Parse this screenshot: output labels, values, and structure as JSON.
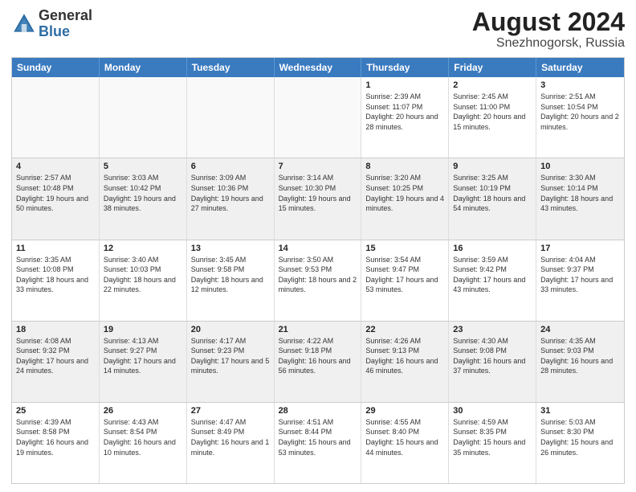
{
  "header": {
    "logo_general": "General",
    "logo_blue": "Blue",
    "title": "August 2024",
    "location": "Snezhnogorsk, Russia"
  },
  "days_of_week": [
    "Sunday",
    "Monday",
    "Tuesday",
    "Wednesday",
    "Thursday",
    "Friday",
    "Saturday"
  ],
  "rows": [
    [
      {
        "day": "",
        "info": "",
        "empty": true
      },
      {
        "day": "",
        "info": "",
        "empty": true
      },
      {
        "day": "",
        "info": "",
        "empty": true
      },
      {
        "day": "",
        "info": "",
        "empty": true
      },
      {
        "day": "1",
        "info": "Sunrise: 2:39 AM\nSunset: 11:07 PM\nDaylight: 20 hours\nand 28 minutes.",
        "empty": false
      },
      {
        "day": "2",
        "info": "Sunrise: 2:45 AM\nSunset: 11:00 PM\nDaylight: 20 hours\nand 15 minutes.",
        "empty": false
      },
      {
        "day": "3",
        "info": "Sunrise: 2:51 AM\nSunset: 10:54 PM\nDaylight: 20 hours\nand 2 minutes.",
        "empty": false
      }
    ],
    [
      {
        "day": "4",
        "info": "Sunrise: 2:57 AM\nSunset: 10:48 PM\nDaylight: 19 hours\nand 50 minutes.",
        "empty": false
      },
      {
        "day": "5",
        "info": "Sunrise: 3:03 AM\nSunset: 10:42 PM\nDaylight: 19 hours\nand 38 minutes.",
        "empty": false
      },
      {
        "day": "6",
        "info": "Sunrise: 3:09 AM\nSunset: 10:36 PM\nDaylight: 19 hours\nand 27 minutes.",
        "empty": false
      },
      {
        "day": "7",
        "info": "Sunrise: 3:14 AM\nSunset: 10:30 PM\nDaylight: 19 hours\nand 15 minutes.",
        "empty": false
      },
      {
        "day": "8",
        "info": "Sunrise: 3:20 AM\nSunset: 10:25 PM\nDaylight: 19 hours\nand 4 minutes.",
        "empty": false
      },
      {
        "day": "9",
        "info": "Sunrise: 3:25 AM\nSunset: 10:19 PM\nDaylight: 18 hours\nand 54 minutes.",
        "empty": false
      },
      {
        "day": "10",
        "info": "Sunrise: 3:30 AM\nSunset: 10:14 PM\nDaylight: 18 hours\nand 43 minutes.",
        "empty": false
      }
    ],
    [
      {
        "day": "11",
        "info": "Sunrise: 3:35 AM\nSunset: 10:08 PM\nDaylight: 18 hours\nand 33 minutes.",
        "empty": false
      },
      {
        "day": "12",
        "info": "Sunrise: 3:40 AM\nSunset: 10:03 PM\nDaylight: 18 hours\nand 22 minutes.",
        "empty": false
      },
      {
        "day": "13",
        "info": "Sunrise: 3:45 AM\nSunset: 9:58 PM\nDaylight: 18 hours\nand 12 minutes.",
        "empty": false
      },
      {
        "day": "14",
        "info": "Sunrise: 3:50 AM\nSunset: 9:53 PM\nDaylight: 18 hours\nand 2 minutes.",
        "empty": false
      },
      {
        "day": "15",
        "info": "Sunrise: 3:54 AM\nSunset: 9:47 PM\nDaylight: 17 hours\nand 53 minutes.",
        "empty": false
      },
      {
        "day": "16",
        "info": "Sunrise: 3:59 AM\nSunset: 9:42 PM\nDaylight: 17 hours\nand 43 minutes.",
        "empty": false
      },
      {
        "day": "17",
        "info": "Sunrise: 4:04 AM\nSunset: 9:37 PM\nDaylight: 17 hours\nand 33 minutes.",
        "empty": false
      }
    ],
    [
      {
        "day": "18",
        "info": "Sunrise: 4:08 AM\nSunset: 9:32 PM\nDaylight: 17 hours\nand 24 minutes.",
        "empty": false
      },
      {
        "day": "19",
        "info": "Sunrise: 4:13 AM\nSunset: 9:27 PM\nDaylight: 17 hours\nand 14 minutes.",
        "empty": false
      },
      {
        "day": "20",
        "info": "Sunrise: 4:17 AM\nSunset: 9:23 PM\nDaylight: 17 hours\nand 5 minutes.",
        "empty": false
      },
      {
        "day": "21",
        "info": "Sunrise: 4:22 AM\nSunset: 9:18 PM\nDaylight: 16 hours\nand 56 minutes.",
        "empty": false
      },
      {
        "day": "22",
        "info": "Sunrise: 4:26 AM\nSunset: 9:13 PM\nDaylight: 16 hours\nand 46 minutes.",
        "empty": false
      },
      {
        "day": "23",
        "info": "Sunrise: 4:30 AM\nSunset: 9:08 PM\nDaylight: 16 hours\nand 37 minutes.",
        "empty": false
      },
      {
        "day": "24",
        "info": "Sunrise: 4:35 AM\nSunset: 9:03 PM\nDaylight: 16 hours\nand 28 minutes.",
        "empty": false
      }
    ],
    [
      {
        "day": "25",
        "info": "Sunrise: 4:39 AM\nSunset: 8:58 PM\nDaylight: 16 hours\nand 19 minutes.",
        "empty": false
      },
      {
        "day": "26",
        "info": "Sunrise: 4:43 AM\nSunset: 8:54 PM\nDaylight: 16 hours\nand 10 minutes.",
        "empty": false
      },
      {
        "day": "27",
        "info": "Sunrise: 4:47 AM\nSunset: 8:49 PM\nDaylight: 16 hours\nand 1 minute.",
        "empty": false
      },
      {
        "day": "28",
        "info": "Sunrise: 4:51 AM\nSunset: 8:44 PM\nDaylight: 15 hours\nand 53 minutes.",
        "empty": false
      },
      {
        "day": "29",
        "info": "Sunrise: 4:55 AM\nSunset: 8:40 PM\nDaylight: 15 hours\nand 44 minutes.",
        "empty": false
      },
      {
        "day": "30",
        "info": "Sunrise: 4:59 AM\nSunset: 8:35 PM\nDaylight: 15 hours\nand 35 minutes.",
        "empty": false
      },
      {
        "day": "31",
        "info": "Sunrise: 5:03 AM\nSunset: 8:30 PM\nDaylight: 15 hours\nand 26 minutes.",
        "empty": false
      }
    ]
  ]
}
